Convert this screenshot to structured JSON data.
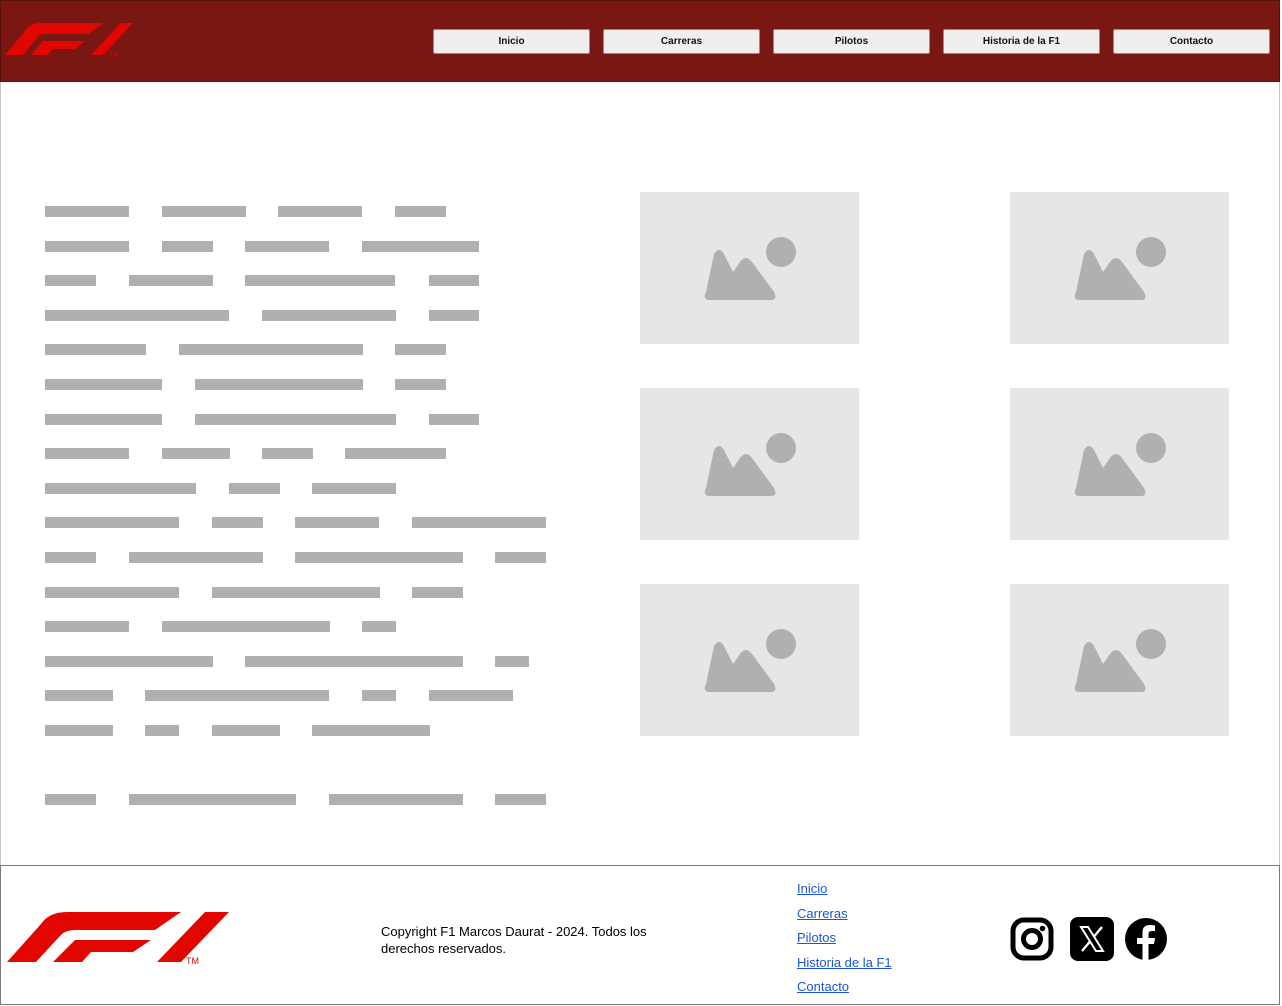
{
  "header": {
    "logo_icon": "f1-logo-icon",
    "nav": [
      "Inicio",
      "Carreras",
      "Pilotos",
      "Historia de la F1",
      "Contacto"
    ]
  },
  "main": {
    "image_placeholder_icon": "image-placeholder-icon",
    "image_count": 6
  },
  "footer": {
    "logo_icon": "f1-logo-icon",
    "copyright": "Copyright F1 Marcos Daurat - 2024. Todos los derechos reservados.",
    "links": [
      "Inicio",
      "Carreras",
      "Pilotos",
      "Historia de la F1",
      "Contacto"
    ],
    "social": [
      "instagram-icon",
      "x-icon",
      "facebook-icon"
    ]
  },
  "colors": {
    "header_bg": "#7a1712",
    "f1_red": "#e10600",
    "placeholder_bg": "#e6e6e6",
    "placeholder_fg": "#b0b0b0",
    "link": "#1a56d6"
  }
}
